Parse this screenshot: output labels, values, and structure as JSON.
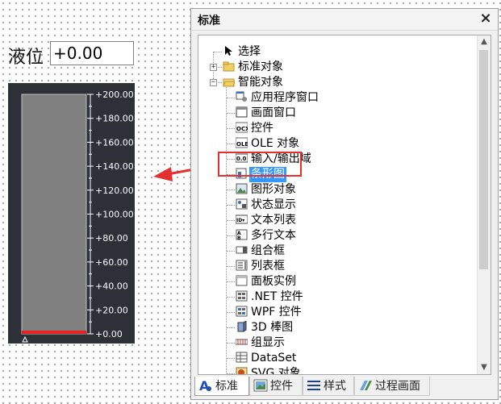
{
  "canvas": {
    "level_label": "液位",
    "level_value": "+0.00"
  },
  "bar_graph": {
    "min": 0,
    "max": 200,
    "current_value": 0,
    "tick_labels": [
      "+200.00",
      "+180.00",
      "+160.00",
      "+140.00",
      "+120.00",
      "+100.00",
      "+80.00",
      "+60.00",
      "+40.00",
      "+20.00",
      "+0.00"
    ],
    "background_color": "#2e3038",
    "bar_color": "#808080",
    "level_color": "#e82020",
    "tick_color": "#ffffff"
  },
  "panel": {
    "title": "标准",
    "close_icon": "close-icon",
    "tree": [
      {
        "label": "选择",
        "icon": "cursor-arrow-icon",
        "level": 1,
        "expander": ""
      },
      {
        "label": "标准对象",
        "icon": "folder-icon",
        "level": 1,
        "expander": "+"
      },
      {
        "label": "智能对象",
        "icon": "folder-open-icon",
        "level": 1,
        "expander": "-"
      },
      {
        "label": "应用程序窗口",
        "icon": "application-window-icon",
        "level": 2
      },
      {
        "label": "画面窗口",
        "icon": "screen-window-icon",
        "level": 2
      },
      {
        "label": "控件",
        "icon": "ocx-control-icon",
        "level": 2
      },
      {
        "label": "OLE 对象",
        "icon": "ole-object-icon",
        "level": 2
      },
      {
        "label": "输入/输出域",
        "icon": "io-field-icon",
        "level": 2
      },
      {
        "label": "条形图",
        "icon": "bar-graph-icon",
        "level": 2,
        "selected": true
      },
      {
        "label": "图形对象",
        "icon": "graphic-object-icon",
        "level": 2
      },
      {
        "label": "状态显示",
        "icon": "status-display-icon",
        "level": 2
      },
      {
        "label": "文本列表",
        "icon": "text-list-icon",
        "level": 2
      },
      {
        "label": "多行文本",
        "icon": "multiline-text-icon",
        "level": 2
      },
      {
        "label": "组合框",
        "icon": "combo-box-icon",
        "level": 2
      },
      {
        "label": "列表框",
        "icon": "list-box-icon",
        "level": 2
      },
      {
        "label": "面板实例",
        "icon": "faceplate-instance-icon",
        "level": 2
      },
      {
        "label": ".NET 控件",
        "icon": "dotnet-control-icon",
        "level": 2
      },
      {
        "label": "WPF 控件",
        "icon": "wpf-control-icon",
        "level": 2
      },
      {
        "label": "3D 棒图",
        "icon": "3d-bar-icon",
        "level": 2
      },
      {
        "label": "组显示",
        "icon": "group-display-icon",
        "level": 2
      },
      {
        "label": "DataSet",
        "icon": "dataset-icon",
        "level": 2
      },
      {
        "label": "SVG 对象",
        "icon": "svg-object-icon",
        "level": 2
      }
    ],
    "tabs": [
      {
        "label": "标准",
        "icon": "standard-tab-icon",
        "active": true
      },
      {
        "label": "控件",
        "icon": "controls-tab-icon"
      },
      {
        "label": "样式",
        "icon": "styles-tab-icon"
      },
      {
        "label": "过程画面",
        "icon": "process-pictures-tab-icon"
      }
    ]
  },
  "colors": {
    "selection": "#3399ff",
    "highlight": "#e53030"
  }
}
